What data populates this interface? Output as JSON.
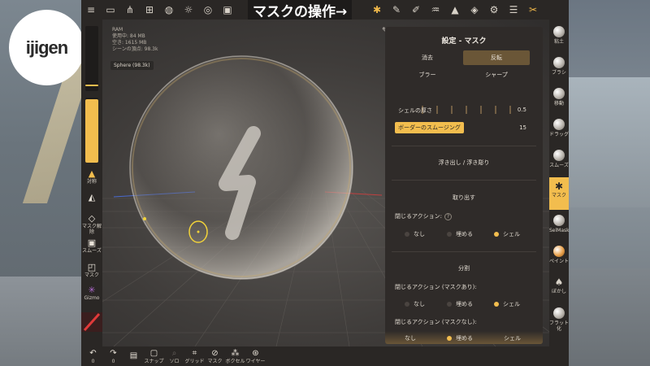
{
  "app": {
    "overlay_caption": "マスクの操作→",
    "logo_text": "ijigen"
  },
  "stats": {
    "ram": "RAM",
    "used": "使用中: 84 MB",
    "free": "空き: 1615 MB",
    "scene_vertices": "シーンの頂点: 98.3k"
  },
  "scene_chip": "Sphere (98.3k)",
  "top_toolbar": {
    "icons": [
      "menu-icon",
      "folder-icon",
      "share-icon",
      "scene-icon",
      "globe-icon",
      "sun-icon",
      "material-icon",
      "image-icon",
      "more-icon"
    ],
    "right_icons": [
      "mask-tool-icon",
      "brush-icon",
      "pen-icon",
      "paint-icon",
      "triangle-icon",
      "layers-icon",
      "gear-icon",
      "sliders-icon",
      "tools-icon"
    ]
  },
  "left_panel": {
    "items": [
      {
        "icon": "symmetry-icon",
        "label": "対称"
      },
      {
        "icon": "paint-bucket-icon",
        "label": ""
      },
      {
        "icon": "eraser-icon",
        "label": "マスク解除"
      },
      {
        "icon": "smooth-icon",
        "label": "スムーズ"
      },
      {
        "icon": "mask-icon",
        "label": "マスク"
      },
      {
        "icon": "gizmo-icon",
        "label": "Gizmo"
      }
    ],
    "radius_level": 0.34
  },
  "bottom_bar": {
    "items": [
      {
        "icon": "undo-icon",
        "label": "0"
      },
      {
        "icon": "redo-icon",
        "label": "0"
      },
      {
        "icon": "save-icon",
        "label": ""
      },
      {
        "icon": "snapshot-icon",
        "label": "スナップ"
      },
      {
        "icon": "zoom-icon",
        "label": "ソロ"
      },
      {
        "icon": "grid-icon",
        "label": "グリッド"
      },
      {
        "icon": "mask-visibility-icon",
        "label": "マスク"
      },
      {
        "icon": "voxel-icon",
        "label": "ボクセル"
      },
      {
        "icon": "wireframe-icon",
        "label": "ワイヤー"
      }
    ]
  },
  "right_tools": {
    "items": [
      {
        "label": "粘土",
        "type": "ball"
      },
      {
        "label": "ブラシ",
        "type": "ball"
      },
      {
        "label": "移動",
        "type": "ball"
      },
      {
        "label": "ドラッグ",
        "type": "ball"
      },
      {
        "label": "スムーズ",
        "type": "ball"
      },
      {
        "label": "マスク",
        "type": "active"
      },
      {
        "label": "SelMask",
        "type": "ball"
      },
      {
        "label": "ペイント",
        "type": "ball"
      },
      {
        "label": "ぼかし",
        "type": "glyph"
      },
      {
        "label": "フラット化",
        "type": "ball"
      }
    ]
  },
  "settings_panel": {
    "title": "設定 - マスク",
    "btn_clear": "消去",
    "btn_invert": "反転",
    "btn_blur": "ブラー",
    "btn_sharpen": "シャープ",
    "shell_label": "シェルの厚さ",
    "shell_value": "0.5",
    "border_label": "ボーダーのスムージング",
    "border_value": "15",
    "emboss": "浮き出し / 浮き彫り",
    "extract": "取り出す",
    "close_action": "閉じるアクション:",
    "help": "?",
    "opt_none": "なし",
    "opt_fill": "埋める",
    "opt_shell": "シェル",
    "split": "分割",
    "close_action_masked": "閉じるアクション (マスクあり):",
    "close_action_unmasked": "閉じるアクション (マスクなし):",
    "extract_selected": "shell",
    "masked_selected": "shell",
    "unmasked_selected": "fill"
  },
  "colors": {
    "accent": "#f2bd4e",
    "panel_bg": "#2f2b29",
    "toolbar_bg": "#2a2725"
  }
}
